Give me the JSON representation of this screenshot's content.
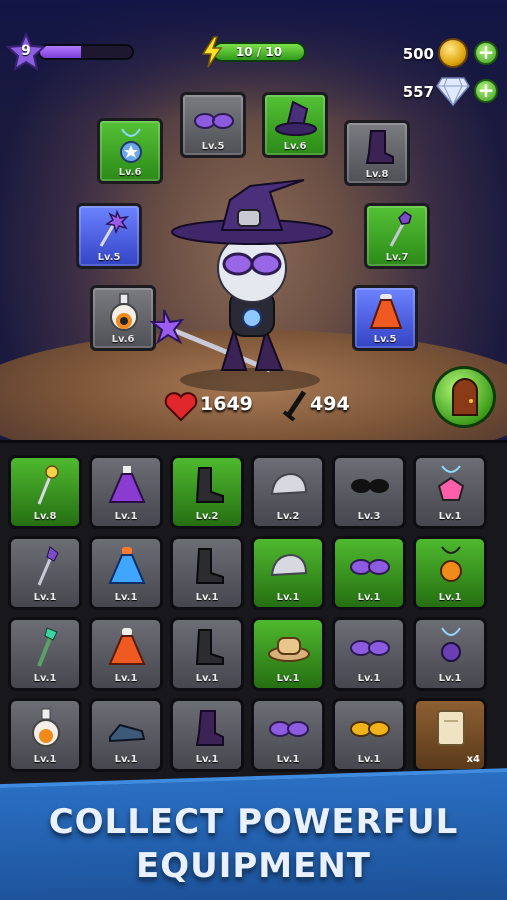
{
  "hud": {
    "player_level": "9",
    "xp_progress": 0.45,
    "energy_text": "10 / 10",
    "coins": "500",
    "gems": "557",
    "plus_symbol": "+"
  },
  "equipped": [
    {
      "name": "amulet",
      "level": "Lv.6",
      "bg": "green",
      "icon": "amulet-icon"
    },
    {
      "name": "glasses",
      "level": "Lv.5",
      "bg": "grey",
      "icon": "glasses-icon"
    },
    {
      "name": "witch-hat",
      "level": "Lv.6",
      "bg": "green",
      "icon": "witch-hat-icon"
    },
    {
      "name": "boots",
      "level": "Lv.8",
      "bg": "grey",
      "icon": "boots-icon"
    },
    {
      "name": "mace",
      "level": "Lv.5",
      "bg": "blue",
      "icon": "mace-icon"
    },
    {
      "name": "scepter",
      "level": "Lv.7",
      "bg": "green",
      "icon": "scepter-icon"
    },
    {
      "name": "potion",
      "level": "Lv.6",
      "bg": "grey",
      "icon": "potion-icon"
    },
    {
      "name": "potion-red",
      "level": "Lv.5",
      "bg": "blue",
      "icon": "red-potion-icon"
    }
  ],
  "stats": {
    "health": "1649",
    "attack": "494"
  },
  "inventory": [
    {
      "level": "Lv.8",
      "bg": "green",
      "icon": "staff-icon"
    },
    {
      "level": "Lv.1",
      "bg": "grey",
      "icon": "purple-potion-icon"
    },
    {
      "level": "Lv.2",
      "bg": "green",
      "icon": "boot-icon"
    },
    {
      "level": "Lv.2",
      "bg": "grey",
      "icon": "cap-icon"
    },
    {
      "level": "Lv.3",
      "bg": "grey",
      "icon": "sunglasses-icon"
    },
    {
      "level": "Lv.1",
      "bg": "grey",
      "icon": "gem-amulet-icon"
    },
    {
      "level": "Lv.1",
      "bg": "grey",
      "icon": "wand-icon"
    },
    {
      "level": "Lv.1",
      "bg": "grey",
      "icon": "blue-potion-icon"
    },
    {
      "level": "Lv.1",
      "bg": "grey",
      "icon": "boot-icon"
    },
    {
      "level": "Lv.1",
      "bg": "green",
      "icon": "cap-icon"
    },
    {
      "level": "Lv.1",
      "bg": "green",
      "icon": "glasses-icon"
    },
    {
      "level": "Lv.1",
      "bg": "green",
      "icon": "fire-amulet-icon"
    },
    {
      "level": "Lv.1",
      "bg": "grey",
      "icon": "green-staff-icon"
    },
    {
      "level": "Lv.1",
      "bg": "grey",
      "icon": "red-potion-icon"
    },
    {
      "level": "Lv.1",
      "bg": "grey",
      "icon": "boot-icon"
    },
    {
      "level": "Lv.1",
      "bg": "green",
      "icon": "hat-icon"
    },
    {
      "level": "Lv.1",
      "bg": "grey",
      "icon": "glasses-icon"
    },
    {
      "level": "Lv.1",
      "bg": "grey",
      "icon": "amulet-icon"
    },
    {
      "level": "Lv.1",
      "bg": "grey",
      "icon": "potion-icon"
    },
    {
      "level": "Lv.1",
      "bg": "grey",
      "icon": "shoe-icon"
    },
    {
      "level": "Lv.1",
      "bg": "grey",
      "icon": "boots-icon"
    },
    {
      "level": "Lv.1",
      "bg": "grey",
      "icon": "glasses-icon"
    },
    {
      "level": "Lv.1",
      "bg": "grey",
      "icon": "yellow-glasses-icon"
    },
    {
      "level": "",
      "bg": "brown",
      "icon": "scroll-icon",
      "qty": "x4"
    }
  ],
  "banner": {
    "line1": "COLLECT POWERFUL",
    "line2": "EQUIPMENT"
  },
  "colors": {
    "green_slot": "#3fa321",
    "grey_slot": "#5d5d64",
    "blue_slot": "#4b5ee0",
    "banner_blue": "#2a6fc3"
  }
}
